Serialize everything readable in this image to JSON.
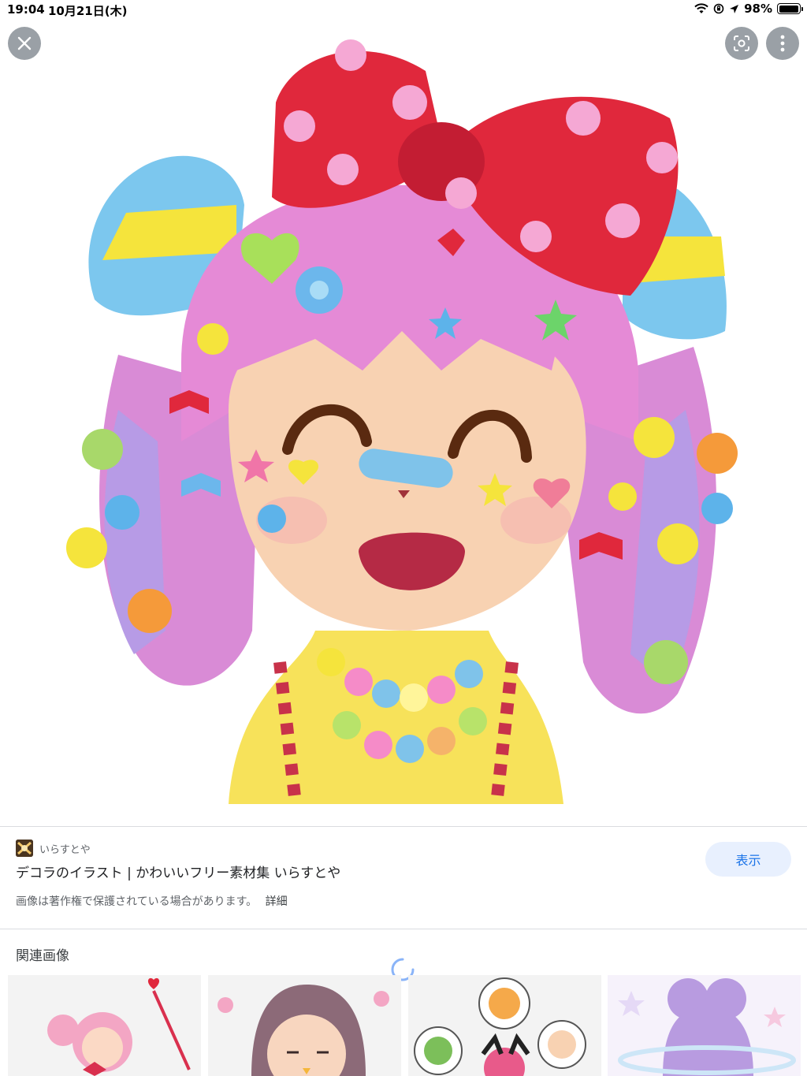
{
  "status_bar": {
    "time": "19:04",
    "date": "10月21日(木)",
    "battery_text": "98%",
    "battery_level": 0.98
  },
  "top_controls": {
    "close_icon": "close-icon",
    "lens_icon": "lens-icon",
    "more_icon": "more-vert-icon"
  },
  "image_info": {
    "source_name": "いらすとや",
    "title": "デコラのイラスト | かわいいフリー素材集 いらすとや",
    "view_button_label": "表示",
    "copyright_notice": "画像は著作権で保護されている場合があります。",
    "details_link": "詳細"
  },
  "related": {
    "header": "関連画像",
    "thumbnails": [
      {
        "name": "magical-girl-thumbnail"
      },
      {
        "name": "long-hair-girl-thumbnail"
      },
      {
        "name": "characters-chat-thumbnail"
      },
      {
        "name": "purple-hair-girl-thumbnail"
      }
    ]
  },
  "colors": {
    "accent": "#1a73e8",
    "button_bg": "#e8f0fe",
    "overlay_button": "#9aa0a6"
  }
}
